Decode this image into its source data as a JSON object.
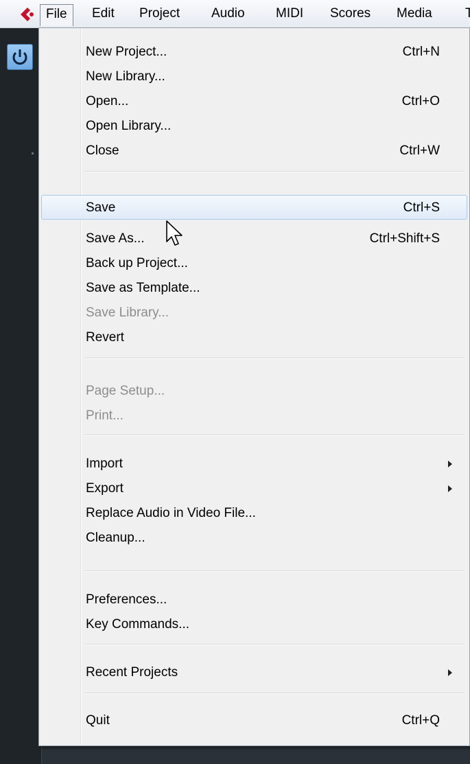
{
  "menubar": {
    "items": [
      "File",
      "Edit",
      "Project",
      "Audio",
      "MIDI",
      "Scores",
      "Media",
      "T"
    ]
  },
  "file_menu": {
    "groups": [
      [
        {
          "label": "New Project...",
          "shortcut": "Ctrl+N"
        },
        {
          "label": "New Library...",
          "shortcut": ""
        },
        {
          "label": "Open...",
          "shortcut": "Ctrl+O"
        },
        {
          "label": "Open Library...",
          "shortcut": ""
        },
        {
          "label": "Close",
          "shortcut": "Ctrl+W"
        }
      ],
      [
        {
          "label": "Save",
          "shortcut": "Ctrl+S",
          "highlighted": true
        },
        {
          "label": "Save As...",
          "shortcut": "Ctrl+Shift+S"
        },
        {
          "label": "Back up Project...",
          "shortcut": ""
        },
        {
          "label": "Save as Template...",
          "shortcut": ""
        },
        {
          "label": "Save Library...",
          "shortcut": "",
          "disabled": true
        },
        {
          "label": "Revert",
          "shortcut": ""
        }
      ],
      [
        {
          "label": "Page Setup...",
          "shortcut": "",
          "disabled": true
        },
        {
          "label": "Print...",
          "shortcut": "",
          "disabled": true
        }
      ],
      [
        {
          "label": "Import",
          "shortcut": "",
          "submenu": true
        },
        {
          "label": "Export",
          "shortcut": "",
          "submenu": true
        },
        {
          "label": "Replace Audio in Video File...",
          "shortcut": ""
        },
        {
          "label": "Cleanup...",
          "shortcut": ""
        }
      ],
      [
        {
          "label": "Preferences...",
          "shortcut": ""
        },
        {
          "label": "Key Commands...",
          "shortcut": ""
        }
      ],
      [
        {
          "label": "Recent Projects",
          "shortcut": "",
          "submenu": true
        }
      ],
      [
        {
          "label": "Quit",
          "shortcut": "Ctrl+Q"
        }
      ]
    ]
  },
  "colors": {
    "highlight_border": "#a9c7ea",
    "disabled_text": "#8d8d8d",
    "menu_bg": "#f0f0f0",
    "logo_red": "#c8102e"
  },
  "icons": {
    "logo": "cubase-logo-icon",
    "power": "power-icon",
    "cursor": "mouse-pointer-icon",
    "submenu": "submenu-arrow-icon"
  }
}
